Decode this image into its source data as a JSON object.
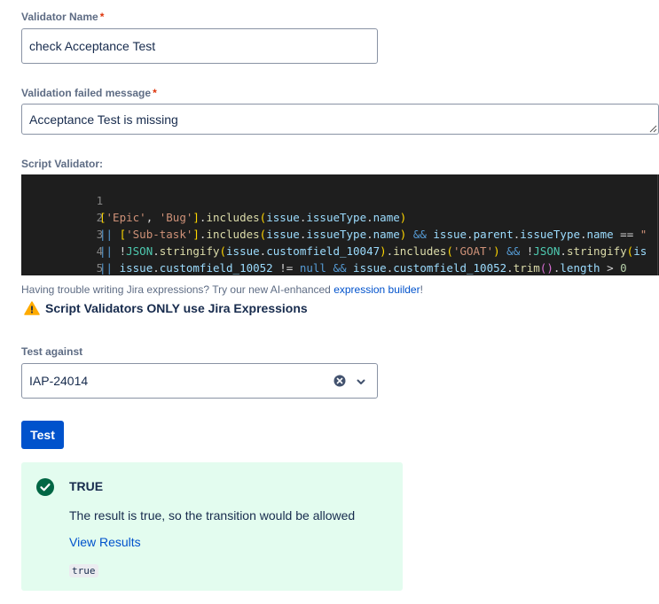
{
  "validator_name": {
    "label": "Validator Name",
    "required_marker": "*",
    "value": "check Acceptance Test"
  },
  "failed_message": {
    "label": "Validation failed message",
    "required_marker": "*",
    "value": "Acceptance Test is missing"
  },
  "script_validator": {
    "label": "Script Validator:",
    "lines": [
      {
        "number": "1",
        "tokens": [
          "['Epic', 'Bug'].includes(issue.issueType.name)"
        ]
      },
      {
        "number": "2",
        "tokens": [
          "|| ['Sub-task'].includes(issue.issueType.name) && issue.parent.issueType.name == \""
        ]
      },
      {
        "number": "3",
        "tokens": [
          "|| !JSON.stringify(issue.customfield_10047).includes('GOAT') && !JSON.stringify(is"
        ]
      },
      {
        "number": "4",
        "tokens": [
          "|| issue.customfield_10052 != null && issue.customfield_10052.trim().length > 0"
        ]
      },
      {
        "number": "5",
        "tokens": [
          ""
        ]
      }
    ]
  },
  "hint": {
    "text": "Having trouble writing Jira expressions? Try our new AI-enhanced ",
    "link": "expression builder",
    "suffix": "!"
  },
  "warning": {
    "icon": "warning-icon",
    "text": "Script Validators ONLY use Jira Expressions"
  },
  "test_against": {
    "label": "Test against",
    "value": "IAP-24014"
  },
  "test_button": {
    "label": "Test"
  },
  "result": {
    "icon": "check-circle-icon",
    "title": "TRUE",
    "message": "The result is true, so the transition would be allowed",
    "link": "View Results",
    "value": "true"
  },
  "colors": {
    "primary": "#0052cc",
    "success_bg": "#e3fcef",
    "success_icon": "#006644",
    "warning": "#ffab00",
    "required": "#de350b"
  }
}
